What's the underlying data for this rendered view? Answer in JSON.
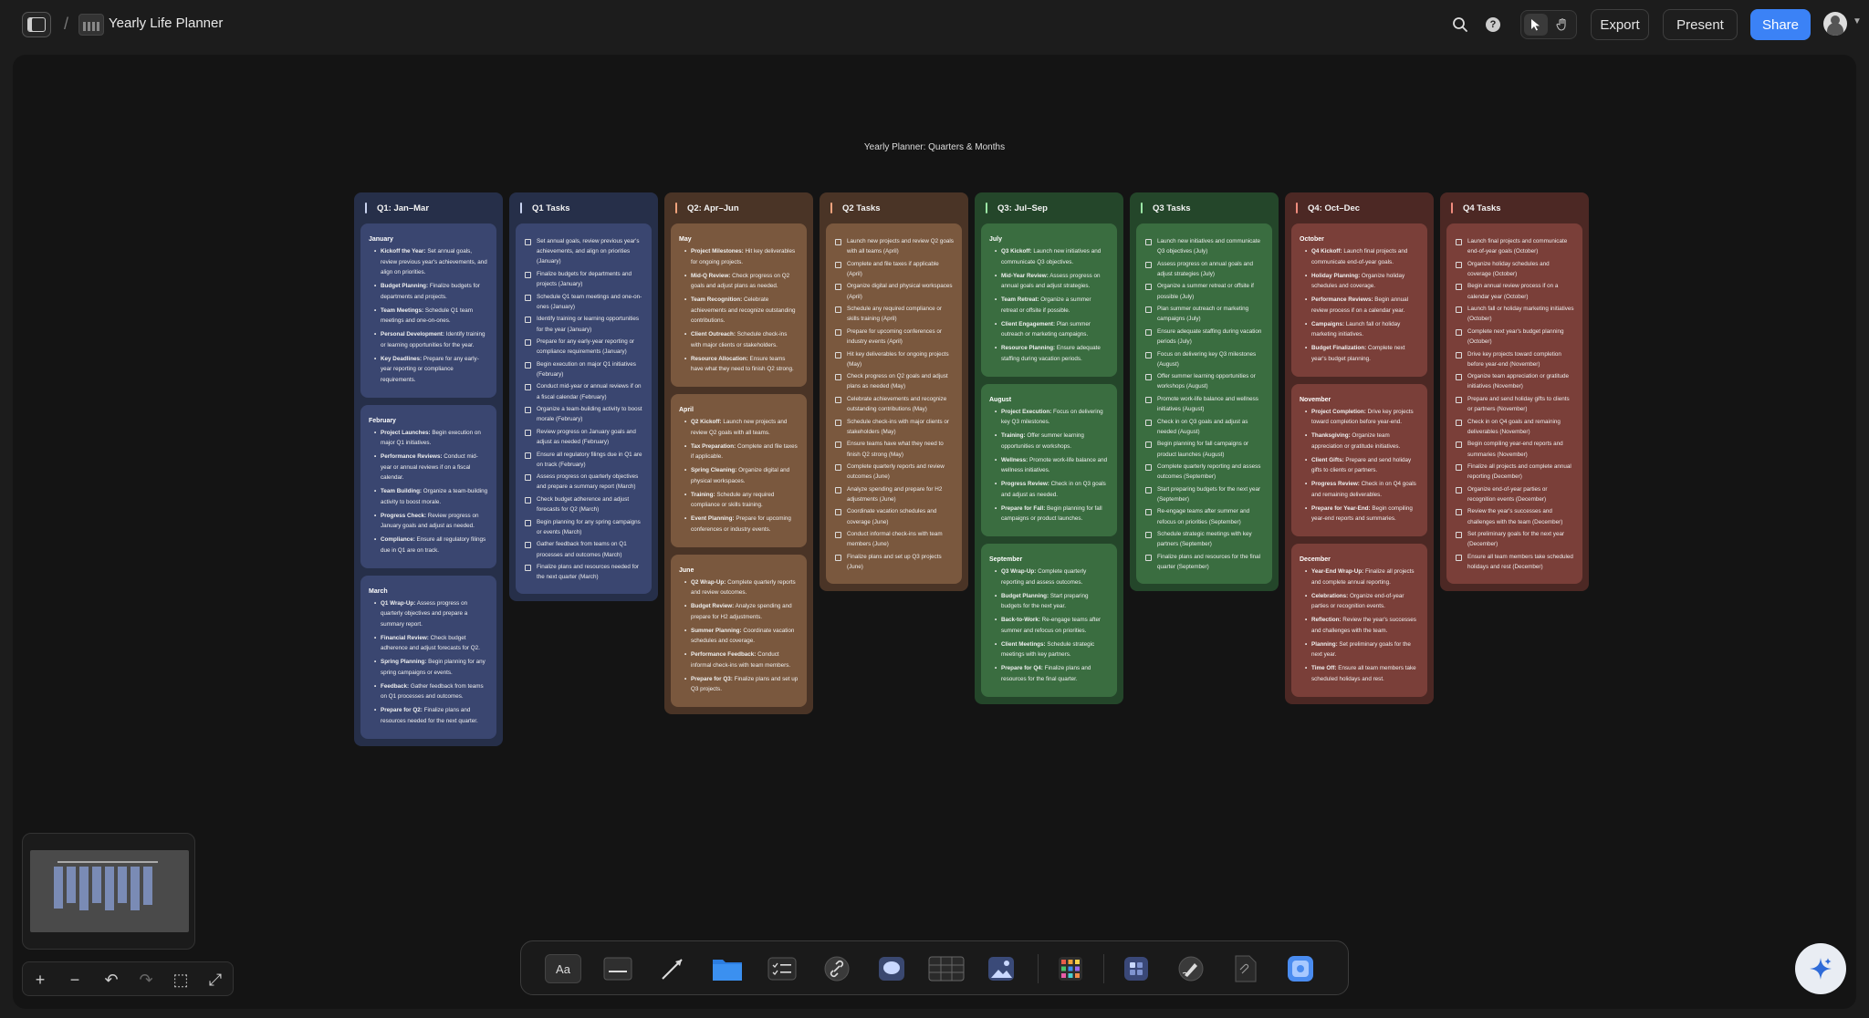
{
  "topbar": {
    "board_title": "Yearly Life Planner",
    "search_icon": "search-icon",
    "help_icon": "help-icon",
    "help_glyph": "?",
    "export_label": "Export",
    "present_label": "Present",
    "share_label": "Share"
  },
  "canvas": {
    "title": "Yearly Planner: Quarters & Months"
  },
  "colors": {
    "q1_col": "#262f49",
    "q1_card": "#3a4670",
    "q1_bar": "#c9d3f0",
    "q2_col": "#4a3426",
    "q2_card": "#7a583e",
    "q2_bar": "#f1a37d",
    "q3_col": "#24462a",
    "q3_card": "#3a6d40",
    "q3_bar": "#9ae6a5",
    "q4_col": "#4c2824",
    "q4_card": "#7a3f39",
    "q4_bar": "#f08c7e",
    "share_blue": "#3b82f6"
  },
  "columns": [
    {
      "title": "Q1: Jan–Mar",
      "type": "months",
      "q": "q1",
      "months": [
        {
          "name": "January",
          "items": [
            {
              "label": "Kickoff the Year:",
              "text": " Set annual goals, review previous year's achievements, and align on priorities."
            },
            {
              "label": "Budget Planning:",
              "text": " Finalize budgets for departments and projects."
            },
            {
              "label": "Team Meetings:",
              "text": " Schedule Q1 team meetings and one-on-ones."
            },
            {
              "label": "Personal Development:",
              "text": " Identify training or learning opportunities for the year."
            },
            {
              "label": "Key Deadlines:",
              "text": " Prepare for any early-year reporting or compliance requirements."
            }
          ]
        },
        {
          "name": "February",
          "items": [
            {
              "label": "Project Launches:",
              "text": " Begin execution on major Q1 initiatives."
            },
            {
              "label": "Performance Reviews:",
              "text": " Conduct mid-year or annual reviews if on a fiscal calendar."
            },
            {
              "label": "Team Building:",
              "text": " Organize a team-building activity to boost morale."
            },
            {
              "label": "Progress Check:",
              "text": " Review progress on January goals and adjust as needed."
            },
            {
              "label": "Compliance:",
              "text": " Ensure all regulatory filings due in Q1 are on track."
            }
          ]
        },
        {
          "name": "March",
          "items": [
            {
              "label": "Q1 Wrap-Up:",
              "text": " Assess progress on quarterly objectives and prepare a summary report."
            },
            {
              "label": "Financial Review:",
              "text": " Check budget adherence and adjust forecasts for Q2."
            },
            {
              "label": "Spring Planning:",
              "text": " Begin planning for any spring campaigns or events."
            },
            {
              "label": "Feedback:",
              "text": " Gather feedback from teams on Q1 processes and outcomes."
            },
            {
              "label": "Prepare for Q2:",
              "text": " Finalize plans and resources needed for the next quarter."
            }
          ]
        }
      ]
    },
    {
      "title": "Q1 Tasks",
      "type": "tasks",
      "q": "q1",
      "tasks": [
        "Set annual goals, review previous year's achievements, and align on priorities (January)",
        "Finalize budgets for departments and projects (January)",
        "Schedule Q1 team meetings and one-on-ones (January)",
        "Identify training or learning opportunities for the year (January)",
        "Prepare for any early-year reporting or compliance requirements (January)",
        "Begin execution on major Q1 initiatives (February)",
        "Conduct mid-year or annual reviews if on a fiscal calendar (February)",
        "Organize a team-building activity to boost morale (February)",
        "Review progress on January goals and adjust as needed (February)",
        "Ensure all regulatory filings due in Q1 are on track (February)",
        "Assess progress on quarterly objectives and prepare a summary report (March)",
        "Check budget adherence and adjust forecasts for Q2 (March)",
        "Begin planning for any spring campaigns or events (March)",
        "Gather feedback from teams on Q1 processes and outcomes (March)",
        "Finalize plans and resources needed for the next quarter (March)"
      ]
    },
    {
      "title": "Q2: Apr–Jun",
      "type": "months",
      "q": "q2",
      "months": [
        {
          "name": "May",
          "items": [
            {
              "label": "Project Milestones:",
              "text": " Hit key deliverables for ongoing projects."
            },
            {
              "label": "Mid-Q Review:",
              "text": " Check progress on Q2 goals and adjust plans as needed."
            },
            {
              "label": "Team Recognition:",
              "text": " Celebrate achievements and recognize outstanding contributions."
            },
            {
              "label": "Client Outreach:",
              "text": " Schedule check-ins with major clients or stakeholders."
            },
            {
              "label": "Resource Allocation:",
              "text": " Ensure teams have what they need to finish Q2 strong."
            }
          ]
        },
        {
          "name": "April",
          "items": [
            {
              "label": "Q2 Kickoff:",
              "text": " Launch new projects and review Q2 goals with all teams."
            },
            {
              "label": "Tax Preparation:",
              "text": " Complete and file taxes if applicable."
            },
            {
              "label": "Spring Cleaning:",
              "text": " Organize digital and physical workspaces."
            },
            {
              "label": "Training:",
              "text": " Schedule any required compliance or skills training."
            },
            {
              "label": "Event Planning:",
              "text": " Prepare for upcoming conferences or industry events."
            }
          ]
        },
        {
          "name": "June",
          "items": [
            {
              "label": "Q2 Wrap-Up:",
              "text": " Complete quarterly reports and review outcomes."
            },
            {
              "label": "Budget Review:",
              "text": " Analyze spending and prepare for H2 adjustments."
            },
            {
              "label": "Summer Planning:",
              "text": " Coordinate vacation schedules and coverage."
            },
            {
              "label": "Performance Feedback:",
              "text": " Conduct informal check-ins with team members."
            },
            {
              "label": "Prepare for Q3:",
              "text": " Finalize plans and set up Q3 projects."
            }
          ]
        }
      ]
    },
    {
      "title": "Q2 Tasks",
      "type": "tasks",
      "q": "q2",
      "tasks": [
        "Launch new projects and review Q2 goals with all teams (April)",
        "Complete and file taxes if applicable (April)",
        "Organize digital and physical workspaces (April)",
        "Schedule any required compliance or skills training (April)",
        "Prepare for upcoming conferences or industry events (April)",
        "Hit key deliverables for ongoing projects (May)",
        "Check progress on Q2 goals and adjust plans as needed (May)",
        "Celebrate achievements and recognize outstanding contributions (May)",
        "Schedule check-ins with major clients or stakeholders (May)",
        "Ensure teams have what they need to finish Q2 strong (May)",
        "Complete quarterly reports and review outcomes (June)",
        "Analyze spending and prepare for H2 adjustments (June)",
        "Coordinate vacation schedules and coverage (June)",
        "Conduct informal check-ins with team members (June)",
        "Finalize plans and set up Q3 projects (June)"
      ]
    },
    {
      "title": "Q3: Jul–Sep",
      "type": "months",
      "q": "q3",
      "months": [
        {
          "name": "July",
          "items": [
            {
              "label": "Q3 Kickoff:",
              "text": " Launch new initiatives and communicate Q3 objectives."
            },
            {
              "label": "Mid-Year Review:",
              "text": " Assess progress on annual goals and adjust strategies."
            },
            {
              "label": "Team Retreat:",
              "text": " Organize a summer retreat or offsite if possible."
            },
            {
              "label": "Client Engagement:",
              "text": " Plan summer outreach or marketing campaigns."
            },
            {
              "label": "Resource Planning:",
              "text": " Ensure adequate staffing during vacation periods."
            }
          ]
        },
        {
          "name": "August",
          "items": [
            {
              "label": "Project Execution:",
              "text": " Focus on delivering key Q3 milestones."
            },
            {
              "label": "Training:",
              "text": " Offer summer learning opportunities or workshops."
            },
            {
              "label": "Wellness:",
              "text": " Promote work-life balance and wellness initiatives."
            },
            {
              "label": "Progress Review:",
              "text": " Check in on Q3 goals and adjust as needed."
            },
            {
              "label": "Prepare for Fall:",
              "text": " Begin planning for fall campaigns or product launches."
            }
          ]
        },
        {
          "name": "September",
          "items": [
            {
              "label": "Q3 Wrap-Up:",
              "text": " Complete quarterly reporting and assess outcomes."
            },
            {
              "label": "Budget Planning:",
              "text": " Start preparing budgets for the next year."
            },
            {
              "label": "Back-to-Work:",
              "text": " Re-engage teams after summer and refocus on priorities."
            },
            {
              "label": "Client Meetings:",
              "text": " Schedule strategic meetings with key partners."
            },
            {
              "label": "Prepare for Q4:",
              "text": " Finalize plans and resources for the final quarter."
            }
          ]
        }
      ]
    },
    {
      "title": "Q3 Tasks",
      "type": "tasks",
      "q": "q3",
      "tasks": [
        "Launch new initiatives and communicate Q3 objectives (July)",
        "Assess progress on annual goals and adjust strategies (July)",
        "Organize a summer retreat or offsite if possible (July)",
        "Plan summer outreach or marketing campaigns (July)",
        "Ensure adequate staffing during vacation periods (July)",
        "Focus on delivering key Q3 milestones (August)",
        "Offer summer learning opportunities or workshops (August)",
        "Promote work-life balance and wellness initiatives (August)",
        "Check in on Q3 goals and adjust as needed (August)",
        "Begin planning for fall campaigns or product launches (August)",
        "Complete quarterly reporting and assess outcomes (September)",
        "Start preparing budgets for the next year (September)",
        "Re-engage teams after summer and refocus on priorities (September)",
        "Schedule strategic meetings with key partners (September)",
        "Finalize plans and resources for the final quarter (September)"
      ]
    },
    {
      "title": "Q4: Oct–Dec",
      "type": "months",
      "q": "q4",
      "months": [
        {
          "name": "October",
          "items": [
            {
              "label": "Q4 Kickoff:",
              "text": " Launch final projects and communicate end-of-year goals."
            },
            {
              "label": "Holiday Planning:",
              "text": " Organize holiday schedules and coverage."
            },
            {
              "label": "Performance Reviews:",
              "text": " Begin annual review process if on a calendar year."
            },
            {
              "label": "Campaigns:",
              "text": " Launch fall or holiday marketing initiatives."
            },
            {
              "label": "Budget Finalization:",
              "text": " Complete next year's budget planning."
            }
          ]
        },
        {
          "name": "November",
          "items": [
            {
              "label": "Project Completion:",
              "text": " Drive key projects toward completion before year-end."
            },
            {
              "label": "Thanksgiving:",
              "text": " Organize team appreciation or gratitude initiatives."
            },
            {
              "label": "Client Gifts:",
              "text": " Prepare and send holiday gifts to clients or partners."
            },
            {
              "label": "Progress Review:",
              "text": " Check in on Q4 goals and remaining deliverables."
            },
            {
              "label": "Prepare for Year-End:",
              "text": " Begin compiling year-end reports and summaries."
            }
          ]
        },
        {
          "name": "December",
          "items": [
            {
              "label": "Year-End Wrap-Up:",
              "text": " Finalize all projects and complete annual reporting."
            },
            {
              "label": "Celebrations:",
              "text": " Organize end-of-year parties or recognition events."
            },
            {
              "label": "Reflection:",
              "text": " Review the year's successes and challenges with the team."
            },
            {
              "label": "Planning:",
              "text": " Set preliminary goals for the next year."
            },
            {
              "label": "Time Off:",
              "text": " Ensure all team members take scheduled holidays and rest."
            }
          ]
        }
      ]
    },
    {
      "title": "Q4 Tasks",
      "type": "tasks",
      "q": "q4",
      "tasks": [
        "Launch final projects and communicate end-of-year goals (October)",
        "Organize holiday schedules and coverage (October)",
        "Begin annual review process if on a calendar year (October)",
        "Launch fall or holiday marketing initiatives (October)",
        "Complete next year's budget planning (October)",
        "Drive key projects toward completion before year-end (November)",
        "Organize team appreciation or gratitude initiatives (November)",
        "Prepare and send holiday gifts to clients or partners (November)",
        "Check in on Q4 goals and remaining deliverables (November)",
        "Begin compiling year-end reports and summaries (November)",
        "Finalize all projects and complete annual reporting (December)",
        "Organize end-of-year parties or recognition events (December)",
        "Review the year's successes and challenges with the team (December)",
        "Set preliminary goals for the next year (December)",
        "Ensure all team members take scheduled holidays and rest (December)"
      ]
    }
  ],
  "zoom_controls": {
    "zoom_in": "+",
    "zoom_out": "−",
    "undo": "↶",
    "redo": "↷",
    "fit": "⬚",
    "fullscreen": "⤢"
  },
  "toolbar": {
    "text_tool_label": "Aa",
    "icons": [
      "text-tool-icon",
      "sticky-note-icon",
      "arrow-tool-icon",
      "folder-icon",
      "checklist-icon",
      "link-icon",
      "comment-icon",
      "table-icon",
      "image-icon",
      "apps-grid-icon",
      "widget-icon",
      "pen-tool-icon",
      "file-icon",
      "ai-tool-icon"
    ]
  },
  "ai_button_icon": "sparkle-icon"
}
